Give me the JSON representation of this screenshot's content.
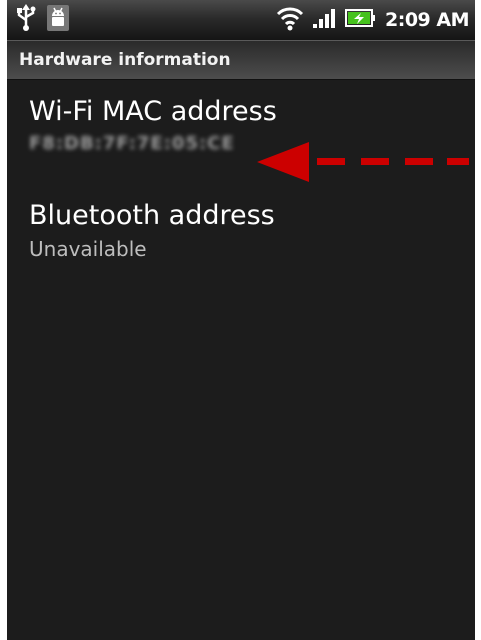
{
  "status_bar": {
    "icons_left": [
      "usb-icon",
      "android-debug-icon"
    ],
    "icons_right": [
      "wifi-icon",
      "signal-icon",
      "battery-charging-icon"
    ],
    "time": "2:09 AM"
  },
  "header": {
    "title": "Hardware information"
  },
  "prefs": [
    {
      "title": "Wi-Fi MAC address",
      "summary": "F8:DB:7F:7E:05:CE"
    },
    {
      "title": "Bluetooth address",
      "summary": "Unavailable"
    }
  ],
  "annotation": {
    "type": "dashed-arrow",
    "color": "#cc0000"
  }
}
